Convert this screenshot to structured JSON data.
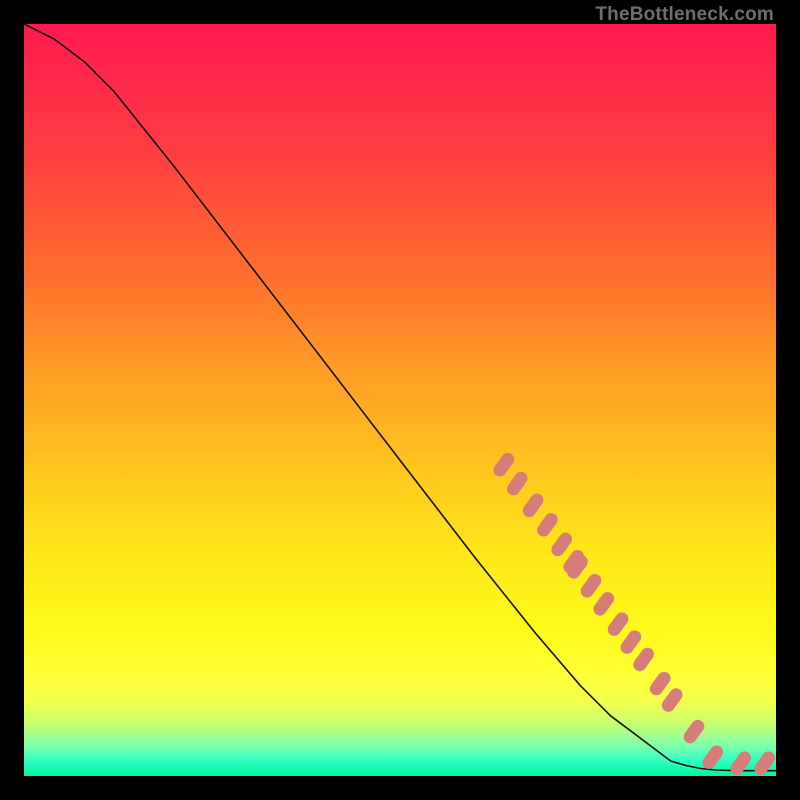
{
  "watermark": "TheBottleneck.com",
  "chart_data": {
    "type": "line",
    "title": "",
    "xlabel": "",
    "ylabel": "",
    "xlim": [
      0,
      100
    ],
    "ylim": [
      0,
      100
    ],
    "grid": false,
    "series": [
      {
        "name": "curve",
        "x": [
          0,
          4,
          8,
          12,
          20,
          30,
          40,
          50,
          60,
          68,
          74,
          78,
          82,
          86,
          88,
          90,
          92,
          95,
          98,
          100
        ],
        "y": [
          100,
          98,
          95,
          91,
          81,
          68,
          55,
          42,
          29,
          19,
          12,
          8,
          5,
          2,
          1.4,
          1.0,
          0.8,
          0.7,
          0.7,
          0.7
        ]
      }
    ],
    "highlight_points": {
      "description": "red/pink rounded markers along lower segment of curve",
      "points": [
        {
          "x": 63.8,
          "y": 41.4
        },
        {
          "x": 65.6,
          "y": 38.9
        },
        {
          "x": 67.7,
          "y": 36.0
        },
        {
          "x": 69.6,
          "y": 33.4
        },
        {
          "x": 71.5,
          "y": 30.8
        },
        {
          "x": 73.6,
          "y": 27.8
        },
        {
          "x": 75.4,
          "y": 25.3
        },
        {
          "x": 77.1,
          "y": 22.9
        },
        {
          "x": 80.7,
          "y": 17.8
        },
        {
          "x": 73.1,
          "y": 28.5
        },
        {
          "x": 79.0,
          "y": 20.2
        },
        {
          "x": 82.4,
          "y": 15.5
        },
        {
          "x": 84.6,
          "y": 12.3
        },
        {
          "x": 86.2,
          "y": 10.1
        },
        {
          "x": 89.1,
          "y": 5.9
        },
        {
          "x": 91.6,
          "y": 2.5
        },
        {
          "x": 95.3,
          "y": 1.7
        },
        {
          "x": 98.5,
          "y": 1.7
        }
      ]
    },
    "gradient_stops_comment": "Background gradient runs top red → orange → yellow → green representing bottleneck severity scale"
  }
}
